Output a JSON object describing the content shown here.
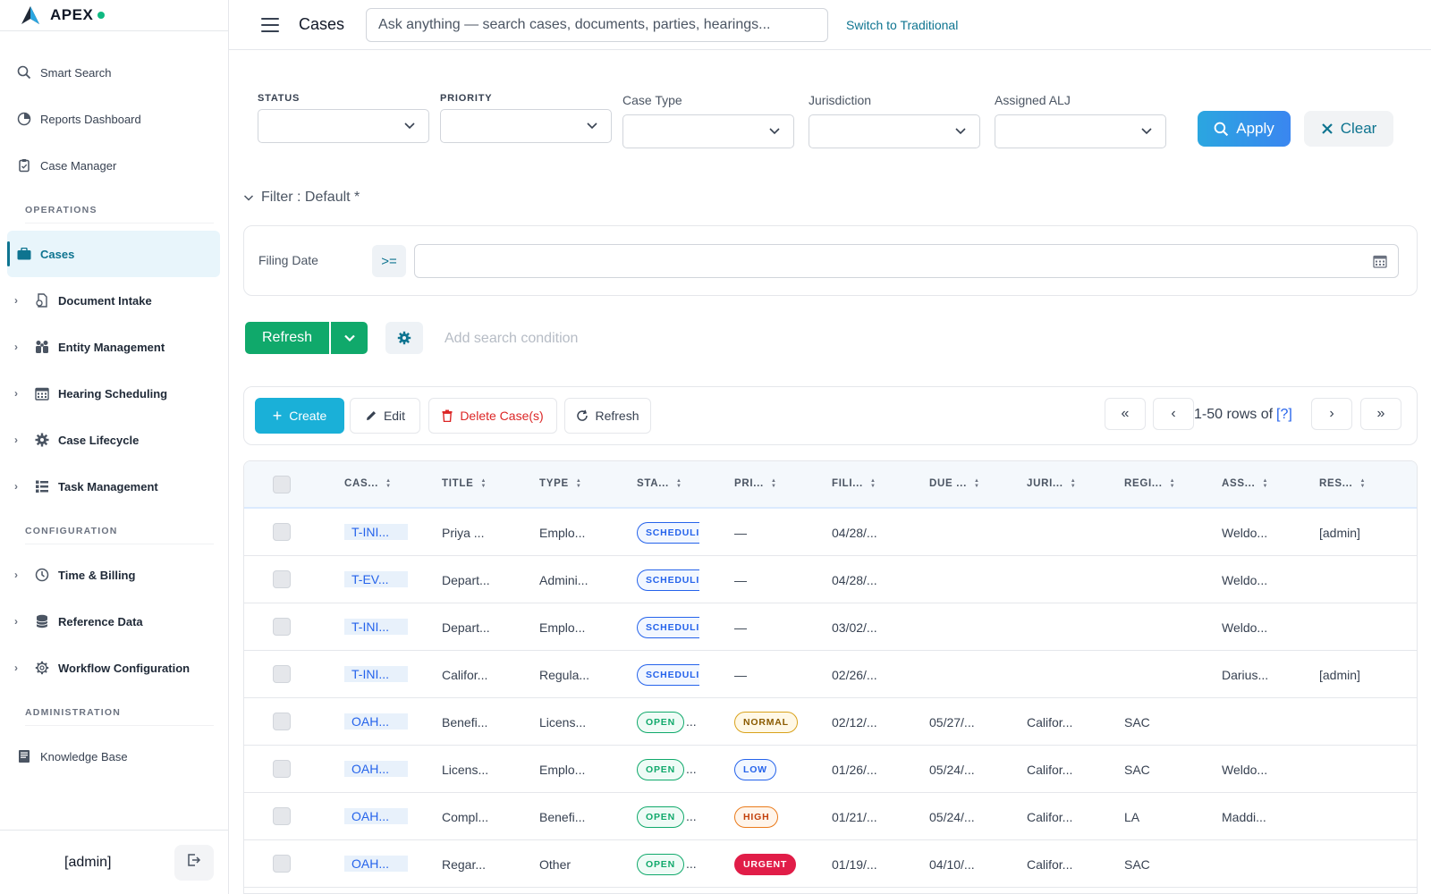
{
  "brand": {
    "name": "APEX"
  },
  "sidebar": {
    "top_items": [
      {
        "label": "Smart Search",
        "icon": "search-icon"
      },
      {
        "label": "Reports Dashboard",
        "icon": "pie-chart-icon"
      },
      {
        "label": "Case Manager",
        "icon": "clipboard-icon"
      }
    ],
    "sections": {
      "operations": "OPERATIONS",
      "configuration": "CONFIGURATION",
      "administration": "ADMINISTRATION"
    },
    "active_item": {
      "label": "Cases",
      "icon": "briefcase-icon"
    },
    "operations_groups": [
      {
        "label": "Document Intake",
        "icon": "document-intake-icon"
      },
      {
        "label": "Entity Management",
        "icon": "people-icon"
      },
      {
        "label": "Hearing Scheduling",
        "icon": "calendar-icon"
      },
      {
        "label": "Case Lifecycle",
        "icon": "gear-icon"
      },
      {
        "label": "Task Management",
        "icon": "list-icon"
      }
    ],
    "configuration_groups": [
      {
        "label": "Time & Billing",
        "icon": "clock-icon"
      },
      {
        "label": "Reference Data",
        "icon": "database-icon"
      },
      {
        "label": "Workflow Configuration",
        "icon": "cog-outline-icon"
      }
    ],
    "admin_items": [
      {
        "label": "Knowledge Base",
        "icon": "book-icon"
      }
    ],
    "footer_user": "[admin]"
  },
  "topbar": {
    "title": "Cases",
    "search_placeholder": "Ask anything — search cases, documents, parties, hearings...",
    "switch_label": "Switch to Traditional"
  },
  "filters": {
    "status_label": "STATUS",
    "priority_label": "PRIORITY",
    "case_type_label": "Case Type",
    "jurisdiction_label": "Jurisdiction",
    "assigned_alj_label": "Assigned ALJ",
    "apply_label": "Apply",
    "clear_label": "Clear"
  },
  "filter_panel": {
    "toggle_label": "Filter : Default *",
    "filing_date_label": "Filing Date",
    "operator": ">="
  },
  "actions": {
    "refresh_label": "Refresh",
    "add_condition_placeholder": "Add search condition"
  },
  "toolbar": {
    "create_label": "Create",
    "edit_label": "Edit",
    "delete_label": "Delete Case(s)",
    "refresh_label": "Refresh",
    "rows_text": "1-50 rows of",
    "rows_total": "[?]"
  },
  "table": {
    "headers": [
      "CAS...",
      "TITLE",
      "TYPE",
      "STA...",
      "PRI...",
      "FILI...",
      "DUE ...",
      "JURI...",
      "REGI...",
      "ASS...",
      "RES..."
    ],
    "rows": [
      {
        "case": "T-INI...",
        "title": "Priya ...",
        "type": "Emplo...",
        "status": "SCHEDULI",
        "status_kind": "sched",
        "priority": "—",
        "priority_kind": "none",
        "filing": "04/28/...",
        "due": "",
        "jurisdiction": "",
        "region": "",
        "assigned": "Weldo...",
        "res": "[admin]"
      },
      {
        "case": "T-EV...",
        "title": "Depart...",
        "type": "Admini...",
        "status": "SCHEDULI",
        "status_kind": "sched",
        "priority": "—",
        "priority_kind": "none",
        "filing": "04/28/...",
        "due": "",
        "jurisdiction": "",
        "region": "",
        "assigned": "Weldo...",
        "res": ""
      },
      {
        "case": "T-INI...",
        "title": "Depart...",
        "type": "Emplo...",
        "status": "SCHEDULI",
        "status_kind": "sched",
        "priority": "—",
        "priority_kind": "none",
        "filing": "03/02/...",
        "due": "",
        "jurisdiction": "",
        "region": "",
        "assigned": "Weldo...",
        "res": ""
      },
      {
        "case": "T-INI...",
        "title": "Califor...",
        "type": "Regula...",
        "status": "SCHEDULI",
        "status_kind": "sched",
        "priority": "—",
        "priority_kind": "none",
        "filing": "02/26/...",
        "due": "",
        "jurisdiction": "",
        "region": "",
        "assigned": "Darius...",
        "res": "[admin]"
      },
      {
        "case": "OAH...",
        "title": "Benefi...",
        "type": "Licens...",
        "status": "OPEN",
        "status_kind": "open",
        "priority": "NORMAL",
        "priority_kind": "normal",
        "filing": "02/12/...",
        "due": "05/27/...",
        "jurisdiction": "Califor...",
        "region": "SAC",
        "assigned": "",
        "res": ""
      },
      {
        "case": "OAH...",
        "title": "Licens...",
        "type": "Emplo...",
        "status": "OPEN",
        "status_kind": "open",
        "priority": "LOW",
        "priority_kind": "low",
        "filing": "01/26/...",
        "due": "05/24/...",
        "jurisdiction": "Califor...",
        "region": "SAC",
        "assigned": "Weldo...",
        "res": ""
      },
      {
        "case": "OAH...",
        "title": "Compl...",
        "type": "Benefi...",
        "status": "OPEN",
        "status_kind": "open",
        "priority": "HIGH",
        "priority_kind": "high",
        "filing": "01/21/...",
        "due": "05/24/...",
        "jurisdiction": "Califor...",
        "region": "LA",
        "assigned": "Maddi...",
        "res": ""
      },
      {
        "case": "OAH...",
        "title": "Regar...",
        "type": "Other",
        "status": "OPEN",
        "status_kind": "open",
        "priority": "URGENT",
        "priority_kind": "urgent",
        "filing": "01/19/...",
        "due": "04/10/...",
        "jurisdiction": "Califor...",
        "region": "SAC",
        "assigned": "",
        "res": ""
      }
    ]
  },
  "colors": {
    "accent": "#0e7490",
    "brand_status": "#10b981",
    "refresh_green": "#10a96b",
    "create_blue": "#1ab0d8",
    "delete_red": "#dc2626"
  }
}
